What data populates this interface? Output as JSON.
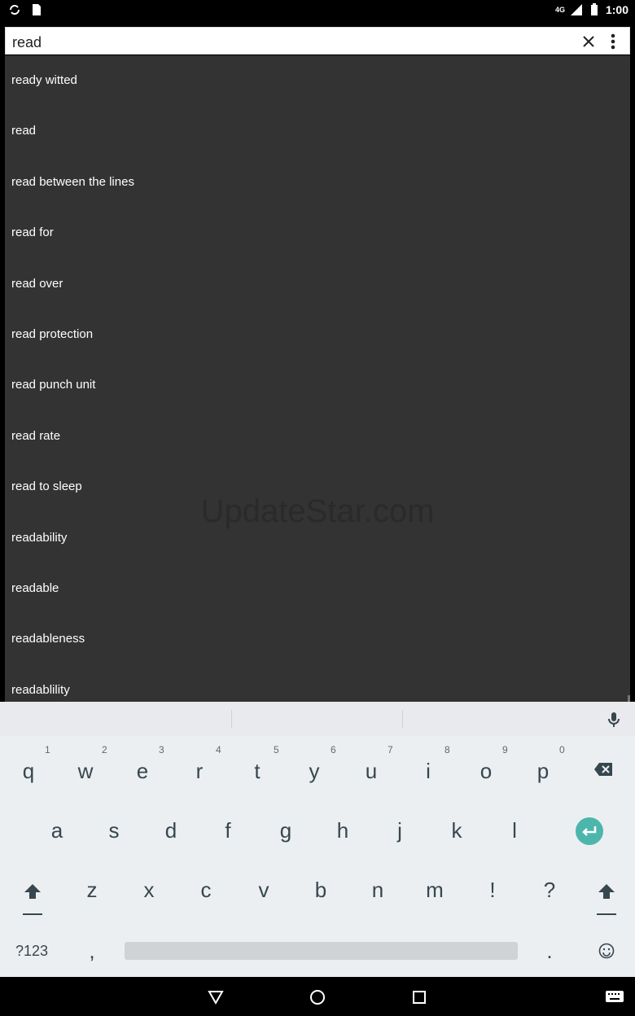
{
  "status_bar": {
    "time": "1:00",
    "network": "4G"
  },
  "search": {
    "query": "read"
  },
  "results": [
    "ready witted",
    "read",
    "read between the lines",
    "read for",
    "read over",
    "read protection",
    "read punch unit",
    "read rate",
    "read to sleep",
    "readability",
    "readable",
    "readableness",
    "readablility"
  ],
  "watermark": "UpdateStar.com",
  "keyboard": {
    "row1": [
      "q",
      "w",
      "e",
      "r",
      "t",
      "y",
      "u",
      "i",
      "o",
      "p"
    ],
    "row1_hints": [
      "1",
      "2",
      "3",
      "4",
      "5",
      "6",
      "7",
      "8",
      "9",
      "0"
    ],
    "row2": [
      "a",
      "s",
      "d",
      "f",
      "g",
      "h",
      "j",
      "k",
      "l"
    ],
    "row3": [
      "z",
      "x",
      "c",
      "v",
      "b",
      "n",
      "m",
      "!",
      "?"
    ],
    "symbols_label": "?123",
    "comma": ",",
    "period": "."
  },
  "colors": {
    "results_bg": "#333333",
    "keyboard_bg": "#eceff1",
    "enter_accent": "#4db6ac"
  }
}
